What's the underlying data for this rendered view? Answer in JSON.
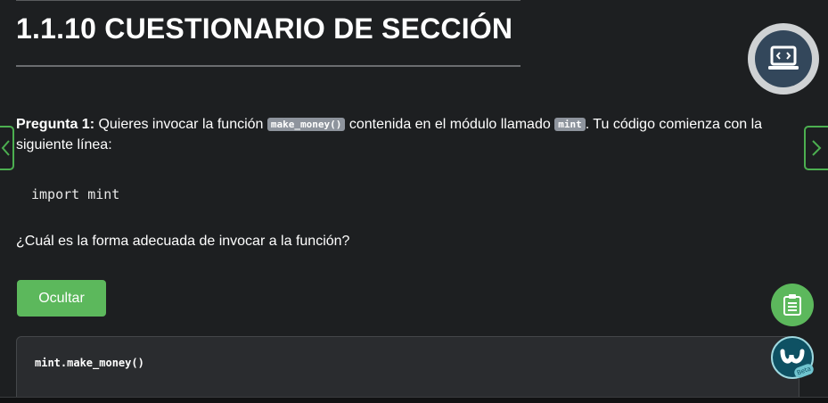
{
  "page": {
    "title": "1.1.10 CUESTIONARIO DE SECCIÓN"
  },
  "question": {
    "label": "Pregunta 1:",
    "text_part1": " Quieres invocar la función ",
    "code1": "make_money()",
    "text_part2": " contenida en el módulo llamado ",
    "code2": "mint",
    "text_part3": ". Tu código comienza con la siguiente línea:",
    "code_line": "import mint",
    "prompt": "¿Cuál es la forma adecuada de invocar a la función?"
  },
  "answer": {
    "toggle_label": "Ocultar",
    "code": "mint.make_money()"
  },
  "floating": {
    "beta_label": "Beta"
  },
  "icons": {
    "prev": "chevron-left-icon",
    "next": "chevron-right-icon",
    "code_view": "laptop-code-icon",
    "notes": "clipboard-icon",
    "assistant": "assistant-logo-icon"
  },
  "colors": {
    "background": "#1d1f21",
    "accent_green": "#5cb85c",
    "nav_border": "#4caf50",
    "code_view_ring": "#cfd2d4",
    "code_view_fill": "#33475b"
  }
}
